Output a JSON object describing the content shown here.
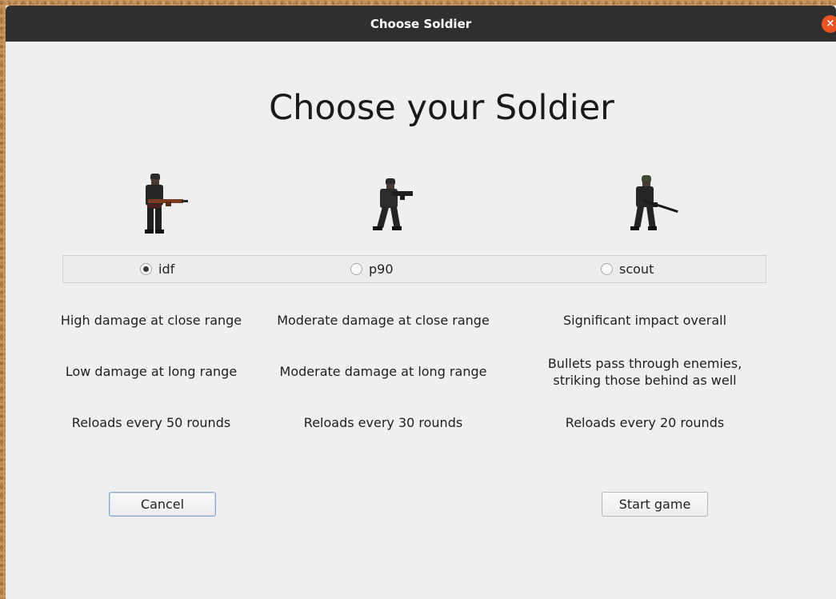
{
  "window": {
    "title": "Choose Soldier",
    "close_glyph": "×"
  },
  "heading": "Choose your Soldier",
  "soldiers": [
    {
      "radio_label": "idf",
      "selected": true,
      "sprite": "soldier-rifle-icon",
      "descriptions": [
        "High damage at close range",
        "Low damage at long range",
        "Reloads every 50 rounds"
      ]
    },
    {
      "radio_label": "p90",
      "selected": false,
      "sprite": "soldier-smg-icon",
      "descriptions": [
        "Moderate damage at close range",
        "Moderate damage at long range",
        "Reloads every 30 rounds"
      ]
    },
    {
      "radio_label": "scout",
      "selected": false,
      "sprite": "soldier-sniper-icon",
      "descriptions": [
        "Significant impact overall",
        "Bullets pass through enemies, striking those behind as well",
        "Reloads every 20 rounds"
      ]
    }
  ],
  "buttons": {
    "cancel": "Cancel",
    "start": "Start game"
  },
  "colors": {
    "titlebar": "#2f2f2f",
    "close": "#e95420",
    "window_bg": "#efefef"
  }
}
